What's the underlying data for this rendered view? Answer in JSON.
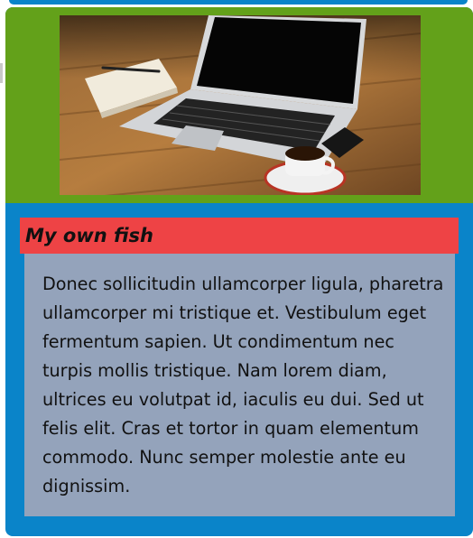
{
  "card": {
    "image_alt": "Laptop on a wooden desk with notebook, pen, phone and espresso cup",
    "title": "My own fish",
    "body": "Donec sollicitudin ullamcorper ligula, pharetra ullamcorper mi tristique et. Vestibulum eget fermentum sapien. Ut condimentum nec turpis mollis tristique. Nam lorem diam, ultrices eu volutpat id, iaculis eu dui. Sed ut felis elit. Cras et tortor in quam elementum commodo. Nunc semper molestie ante eu dignissim."
  },
  "colors": {
    "card_background": "#0a84c9",
    "image_background": "#63a11a",
    "title_background": "#ee4345",
    "body_background": "#94a3bb"
  }
}
